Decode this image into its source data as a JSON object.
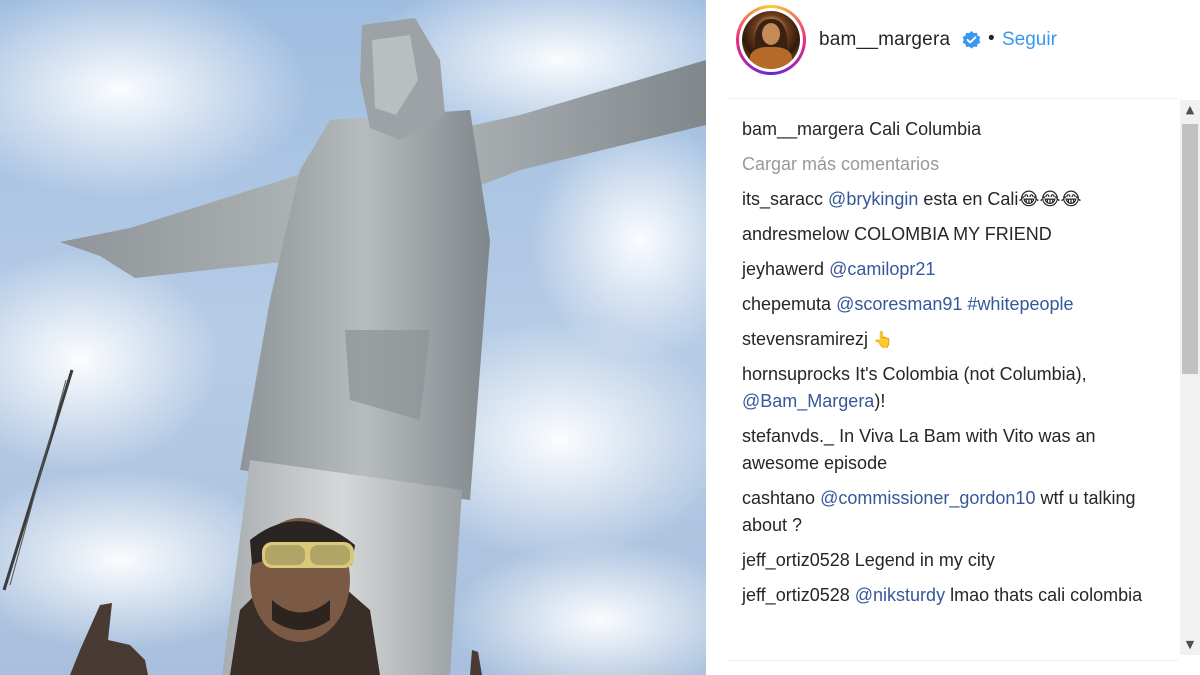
{
  "post": {
    "photo_alt": "statue",
    "author": {
      "username": "bam__margera",
      "verified": true,
      "separator": "•",
      "follow_label": "Seguir"
    },
    "caption": {
      "user": "bam__margera",
      "text": "Cali Columbia"
    },
    "load_more_label": "Cargar más comentarios",
    "comments": [
      {
        "user": "its_saracc",
        "mention": "@brykingin",
        "text": " esta en Cali😂😂😂"
      },
      {
        "user": "andresmelow",
        "text": "COLOMBIA MY FRIEND"
      },
      {
        "user": "jeyhawerd",
        "mention": "@camilopr21",
        "text": ""
      },
      {
        "user": "chepemuta",
        "mention": "@scoresman91",
        "hashtag": "#whitepeople",
        "text": " "
      },
      {
        "user": "stevensramirezj",
        "text": "👆"
      },
      {
        "user": "hornsuprocks",
        "text": "It's Colombia (not Columbia), ",
        "mention_after": "@Bam_Margera",
        "text_after": ")!"
      },
      {
        "user": "stefanvds._",
        "text": "In Viva La Bam with Vito was an awesome episode"
      },
      {
        "user": "cashtano",
        "mention": "@commissioner_gordon10",
        "text": " wtf u talking about ?"
      },
      {
        "user": "jeff_ortiz0528",
        "text": "Legend in my city"
      },
      {
        "user": "jeff_ortiz0528",
        "mention": "@niksturdy",
        "text": " lmao thats cali colombia"
      }
    ]
  },
  "colors": {
    "link_blue": "#3897f0",
    "mention_blue": "#365899",
    "muted_gray": "#999999",
    "text": "#262626"
  },
  "icons": {
    "verified": "verified-badge-icon",
    "scroll_up": "scroll-up-arrow-icon",
    "scroll_down": "scroll-down-arrow-icon"
  }
}
